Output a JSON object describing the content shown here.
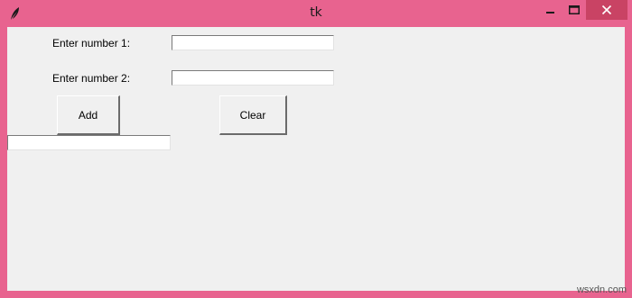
{
  "window": {
    "title": "tk",
    "icons": {
      "app": "feather-icon",
      "minimize": "minimize-icon",
      "maximize": "maximize-icon",
      "close": "close-icon"
    },
    "colors": {
      "frame": "#e8638f",
      "close_hover": "#c94364",
      "client_bg": "#f0f0f0"
    }
  },
  "form": {
    "label1": "Enter number 1:",
    "label2": "Enter number 2:",
    "entry1_value": "",
    "entry2_value": "",
    "add_label": "Add",
    "clear_label": "Clear",
    "result_value": ""
  },
  "watermark": "wsxdn.com"
}
